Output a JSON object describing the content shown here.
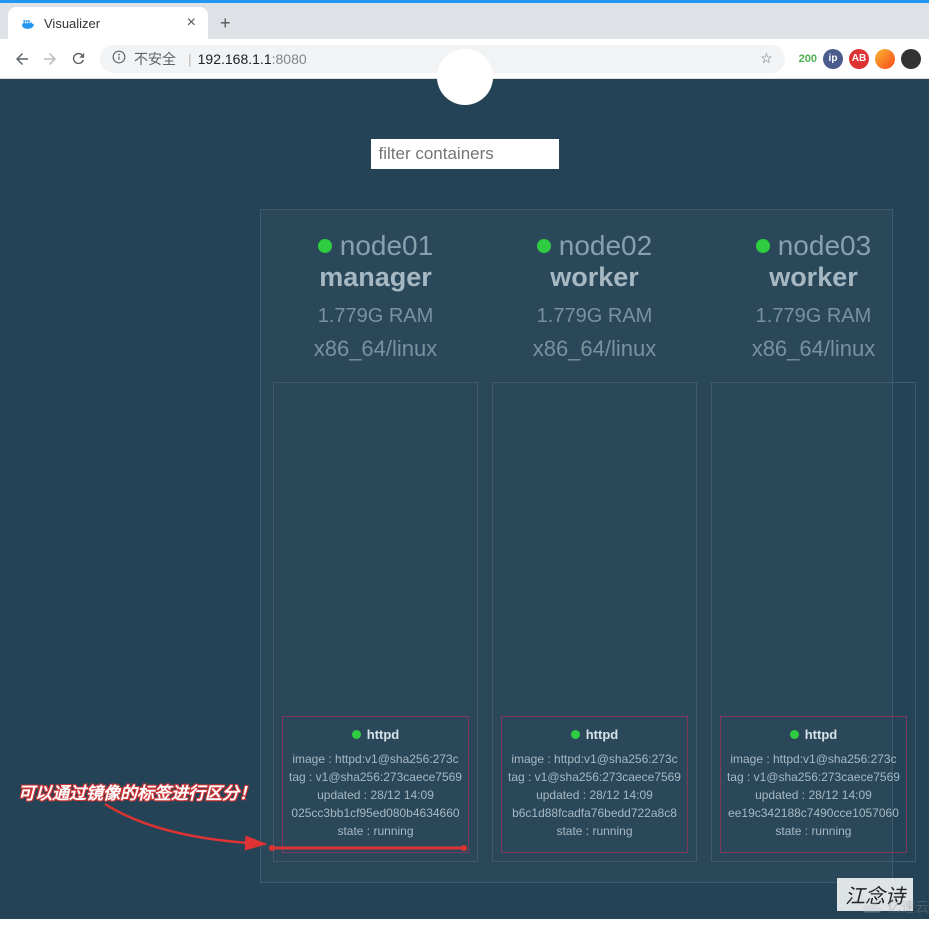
{
  "browser": {
    "tab": {
      "title": "Visualizer"
    },
    "url": {
      "insecure_label": "不安全",
      "host": "192.168.1.1",
      "port": ":8080"
    },
    "ext_status": "200"
  },
  "filter": {
    "placeholder": "filter containers"
  },
  "nodes": [
    {
      "name": "node01",
      "role": "manager",
      "ram": "1.779G RAM",
      "arch": "x86_64/linux",
      "containers": [
        {
          "name": "httpd",
          "image": "image : httpd:v1@sha256:273c",
          "tag": "tag : v1@sha256:273caece7569",
          "updated": "updated : 28/12 14:09",
          "id": "025cc3bb1cf95ed080b4634660",
          "state": "state : running"
        }
      ]
    },
    {
      "name": "node02",
      "role": "worker",
      "ram": "1.779G RAM",
      "arch": "x86_64/linux",
      "containers": [
        {
          "name": "httpd",
          "image": "image : httpd:v1@sha256:273c",
          "tag": "tag : v1@sha256:273caece7569",
          "updated": "updated : 28/12 14:09",
          "id": "b6c1d88fcadfa76bedd722a8c8",
          "state": "state : running"
        }
      ]
    },
    {
      "name": "node03",
      "role": "worker",
      "ram": "1.779G RAM",
      "arch": "x86_64/linux",
      "containers": [
        {
          "name": "httpd",
          "image": "image : httpd:v1@sha256:273c",
          "tag": "tag : v1@sha256:273caece7569",
          "updated": "updated : 28/12 14:09",
          "id": "ee19c342188c7490cce1057060",
          "state": "state : running"
        }
      ]
    }
  ],
  "annotation": {
    "text": "可以通过镜像的标签进行区分！"
  },
  "watermark": {
    "text": "江念诗",
    "logo": "亿速云"
  }
}
